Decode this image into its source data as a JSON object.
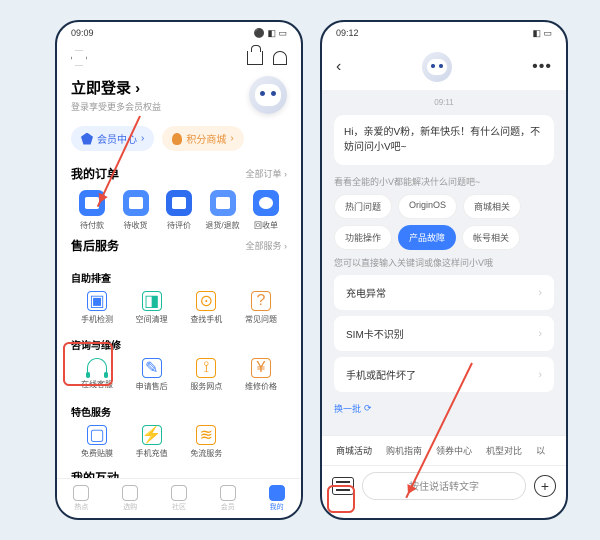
{
  "p1": {
    "time": "09:09",
    "login_title": "立即登录",
    "login_sub": "登录享受更多会员权益",
    "pills": {
      "member": "会员中心",
      "points": "积分商城"
    },
    "orders": {
      "title": "我的订单",
      "more": "全部订单",
      "items": [
        "待付款",
        "待收货",
        "待评价",
        "退货/退款",
        "回收单"
      ]
    },
    "service": {
      "title": "售后服务",
      "more": "全部服务",
      "self_check": "自助排查",
      "self_items": [
        "手机检测",
        "空间清理",
        "查找手机",
        "常见问题"
      ],
      "consult": "咨询与维修",
      "consult_items": [
        "在线客服",
        "申请售后",
        "服务网点",
        "维修价格"
      ],
      "special": "特色服务",
      "special_items": [
        "免费贴膜",
        "手机充值",
        "免流服务"
      ]
    },
    "interact": {
      "title": "我的互动"
    },
    "nav": [
      "热点",
      "选购",
      "社区",
      "会员",
      "我的"
    ]
  },
  "p2": {
    "time": "09:12",
    "ts": "09:11",
    "greeting": "Hi，亲爱的V粉，新年快乐！有什么问题，不妨问问小V吧~",
    "hint1": "看看全能的小V都能解决什么问题吧~",
    "chips": [
      "热门问题",
      "OriginOS",
      "商城相关",
      "功能操作",
      "产品故障",
      "帐号相关"
    ],
    "hint2": "您可以直接输入关键词或像这样问小V哦",
    "faq": [
      "充电异常",
      "SIM卡不识别",
      "手机或配件坏了"
    ],
    "refresh": "换一批",
    "tabs": [
      "商城活动",
      "购机指南",
      "领券中心",
      "机型对比",
      "以"
    ],
    "voice": "按住说话转文字"
  }
}
